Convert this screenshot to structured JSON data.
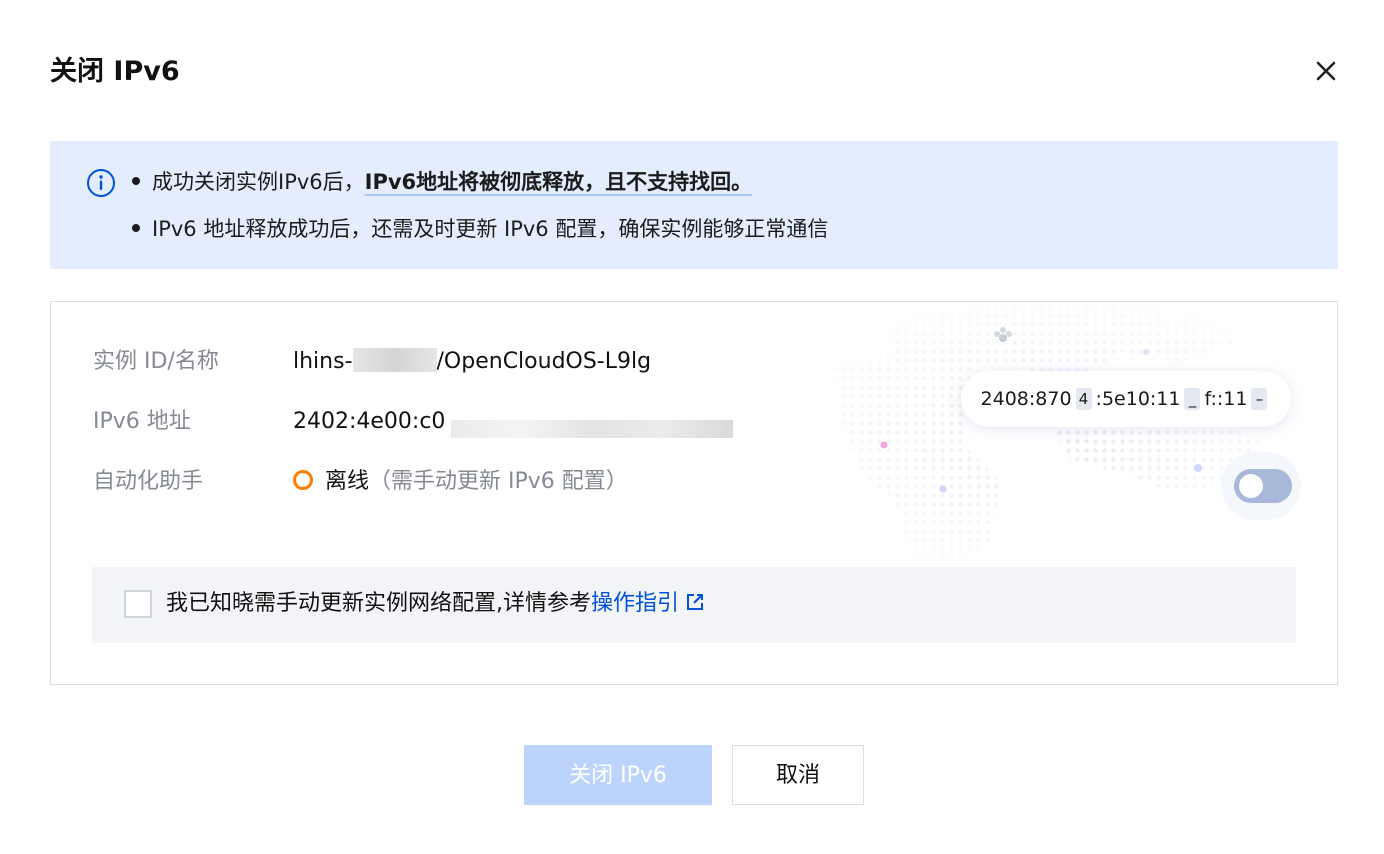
{
  "dialog": {
    "title": "关闭 IPv6"
  },
  "notice": {
    "line1_prefix": "成功关闭实例IPv6后，",
    "line1_bold": "IPv6地址将被彻底释放，且不支持找回。",
    "line2": "IPv6 地址释放成功后，还需及时更新 IPv6 配置，确保实例能够正常通信"
  },
  "details": {
    "instance_label": "实例 ID/名称",
    "instance_prefix": "lhins-",
    "instance_suffix": "/OpenCloudOS-L9lg",
    "ipv6_label": "IPv6 地址",
    "ipv6_prefix": "2402:4e00:c0",
    "assistant_label": "自动化助手",
    "assistant_status": "离线",
    "assistant_note": "（需手动更新 IPv6 配置）"
  },
  "illustration": {
    "ip_part1": "2408:870",
    "ip_mask1": "4",
    "ip_part2": ":5e10:11",
    "ip_mask2": "_",
    "ip_part3": "f::11",
    "ip_mask3": "–"
  },
  "ack": {
    "text": "我已知晓需手动更新实例网络配置,详情参考",
    "link": "操作指引"
  },
  "footer": {
    "confirm_label": "关闭 IPv6",
    "cancel_label": "取消"
  },
  "colors": {
    "notice_bg": "#e3edfd",
    "accent": "#0052d9",
    "status_offline": "#ff7d00",
    "primary_disabled": "#bcd4fb"
  }
}
